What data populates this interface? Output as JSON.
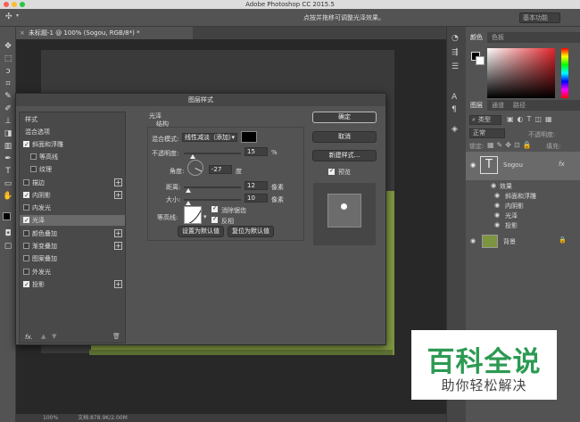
{
  "app": {
    "title": "Adobe Photoshop CC 2015.5"
  },
  "options_bar": {
    "hint": "点按并拖移可调整光泽效果。",
    "workspace": "基本功能"
  },
  "document_tab": {
    "label": "未标题-1 @ 100% (Sogou, RGB/8*) *"
  },
  "status": {
    "zoom": "100%",
    "doc_size": "文档:878.9K/2.00M"
  },
  "right_panel": {
    "color_tabs": [
      "颜色",
      "色板"
    ],
    "layer_tabs": [
      "图层",
      "通道",
      "路径"
    ],
    "kind_filter": "类型",
    "blend_mode": "正常",
    "opacity_label": "不透明度:",
    "lock_label": "锁定:",
    "fill_label": "填充:",
    "layers": [
      {
        "name": "Sogou",
        "fx": "fx"
      },
      {
        "name": "效果"
      },
      {
        "name": "斜面和浮雕"
      },
      {
        "name": "内阴影"
      },
      {
        "name": "光泽"
      },
      {
        "name": "投影"
      },
      {
        "name": "背景"
      }
    ]
  },
  "dialog": {
    "title": "图层样式",
    "styles_header": "样式",
    "blend_options": "混合选项",
    "items": [
      {
        "label": "斜面和浮雕",
        "checked": true,
        "plus": false
      },
      {
        "label": "等高线",
        "checked": false,
        "plus": false
      },
      {
        "label": "纹理",
        "checked": false,
        "plus": false
      },
      {
        "label": "描边",
        "checked": false,
        "plus": true
      },
      {
        "label": "内阴影",
        "checked": true,
        "plus": true
      },
      {
        "label": "内发光",
        "checked": false,
        "plus": false
      },
      {
        "label": "光泽",
        "checked": true,
        "plus": false
      },
      {
        "label": "颜色叠加",
        "checked": false,
        "plus": true
      },
      {
        "label": "渐变叠加",
        "checked": false,
        "plus": true
      },
      {
        "label": "图案叠加",
        "checked": false,
        "plus": false
      },
      {
        "label": "外发光",
        "checked": false,
        "plus": false
      },
      {
        "label": "投影",
        "checked": true,
        "plus": true
      }
    ],
    "footer_fx": "fx.",
    "satin": {
      "title": "光泽",
      "structure": "结构",
      "blend_label": "混合模式:",
      "blend_value": "线性减淡（添加）",
      "opacity_label": "不透明度:",
      "opacity_value": "15",
      "opacity_unit": "%",
      "opacity_level": 0.15,
      "angle_label": "角度:",
      "angle_value": "-27",
      "angle_unit": "度",
      "distance_label": "距离:",
      "distance_value": "12",
      "distance_unit": "像素",
      "size_label": "大小:",
      "size_value": "10",
      "size_unit": "像素",
      "contour_label": "等高线:",
      "antialias_label": "消除锯齿",
      "invert_label": "反相",
      "set_default": "设置为默认值",
      "reset_default": "复位为默认值"
    },
    "buttons": {
      "ok": "确定",
      "cancel": "取消",
      "new_style": "新建样式...",
      "preview": "预览"
    }
  },
  "watermark": {
    "line1": "百科全说",
    "line2": "助你轻松解决"
  }
}
